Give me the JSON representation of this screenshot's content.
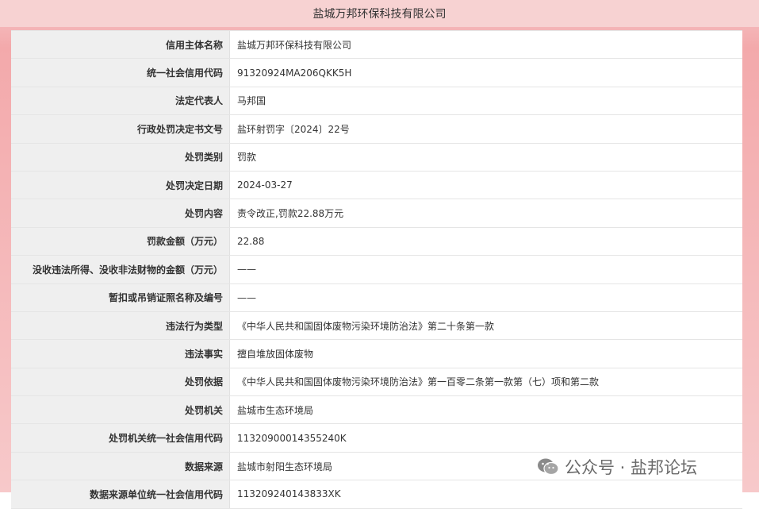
{
  "header": {
    "title": "盐城万邦环保科技有限公司"
  },
  "rows": [
    {
      "label": "信用主体名称",
      "value": "盐城万邦环保科技有限公司"
    },
    {
      "label": "统一社会信用代码",
      "value": "91320924MA206QKK5H"
    },
    {
      "label": "法定代表人",
      "value": "马邦国"
    },
    {
      "label": "行政处罚决定书文号",
      "value": "盐环射罚字〔2024〕22号"
    },
    {
      "label": "处罚类别",
      "value": "罚款"
    },
    {
      "label": "处罚决定日期",
      "value": "2024-03-27"
    },
    {
      "label": "处罚内容",
      "value": "责令改正,罚款22.88万元"
    },
    {
      "label": "罚款金额（万元）",
      "value": "22.88"
    },
    {
      "label": "没收违法所得、没收非法财物的金额（万元）",
      "value": "——"
    },
    {
      "label": "暂扣或吊销证照名称及编号",
      "value": "——"
    },
    {
      "label": "违法行为类型",
      "value": "《中华人民共和国固体废物污染环境防治法》第二十条第一款"
    },
    {
      "label": "违法事实",
      "value": "擅自堆放固体废物"
    },
    {
      "label": "处罚依据",
      "value": "《中华人民共和国固体废物污染环境防治法》第一百零二条第一款第（七）项和第二款"
    },
    {
      "label": "处罚机关",
      "value": "盐城市生态环境局"
    },
    {
      "label": "处罚机关统一社会信用代码",
      "value": "11320900014355240K"
    },
    {
      "label": "数据来源",
      "value": "盐城市射阳生态环境局"
    },
    {
      "label": "数据来源单位统一社会信用代码",
      "value": "113209240143833XK"
    }
  ],
  "watermark": {
    "text": "公众号 · 盐邦论坛",
    "icon": "wechat-icon"
  }
}
